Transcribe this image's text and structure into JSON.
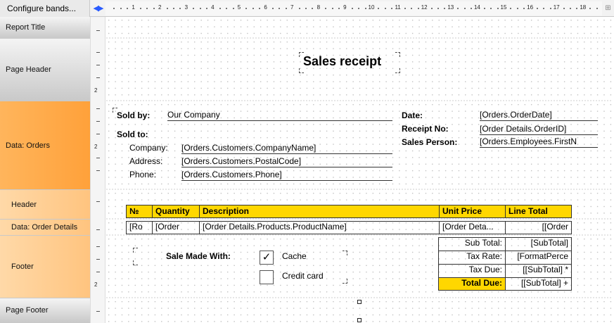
{
  "toolbar": {
    "configure_bands": "Configure bands..."
  },
  "ruler": {
    "numbers": [
      "1",
      "2",
      "3",
      "4",
      "5",
      "6",
      "7",
      "8",
      "9",
      "10",
      "11",
      "12",
      "13",
      "14",
      "15",
      "16",
      "17",
      "18"
    ]
  },
  "bands": {
    "report_title": "Report Title",
    "page_header": "Page Header",
    "data_orders": "Data: Orders",
    "header": "Header",
    "data_order_details": "Data: Order Details",
    "footer": "Footer",
    "page_footer": "Page Footer"
  },
  "page_header": {
    "title": "Sales receipt"
  },
  "orders": {
    "sold_by_label": "Sold by:",
    "company_value": "Our Company",
    "sold_to_label": "Sold to:",
    "company_label": "Company:",
    "company_field": "[Orders.Customers.CompanyName]",
    "address_label": "Address:",
    "address_field": "[Orders.Customers.PostalCode]",
    "phone_label": "Phone:",
    "phone_field": "[Orders.Customers.Phone]",
    "date_label": "Date:",
    "date_field": "[Orders.OrderDate]",
    "receipt_label": "Receipt No:",
    "receipt_field": "[Order Details.OrderID]",
    "salesperson_label": "Sales Person:",
    "salesperson_field": "[Orders.Employees.FirstN"
  },
  "details_header": {
    "columns": [
      "№",
      "Quantity",
      "Description",
      "Unit Price",
      "Line Total"
    ]
  },
  "details_row": {
    "cells": [
      "[Ro",
      "[Order",
      "[Order Details.Products.ProductName]",
      "[Order Deta...",
      "[[Order"
    ]
  },
  "footer": {
    "sale_made_with": "Sale Made With:",
    "options": [
      "Cache",
      "Credit card"
    ],
    "cache_checked": true,
    "credit_checked": false,
    "totals": [
      {
        "label": "Sub Total:",
        "value": "[SubTotal]"
      },
      {
        "label": "Tax Rate:",
        "value": "[FormatPerce"
      },
      {
        "label": "Tax Due:",
        "value": "[[SubTotal] *"
      },
      {
        "label": "Total Due:",
        "value": "[[SubTotal] +"
      }
    ]
  },
  "colors": {
    "header_fill": "#ffd700",
    "band_orange": "#ffa13a",
    "band_light_orange": "#ffc47f"
  }
}
